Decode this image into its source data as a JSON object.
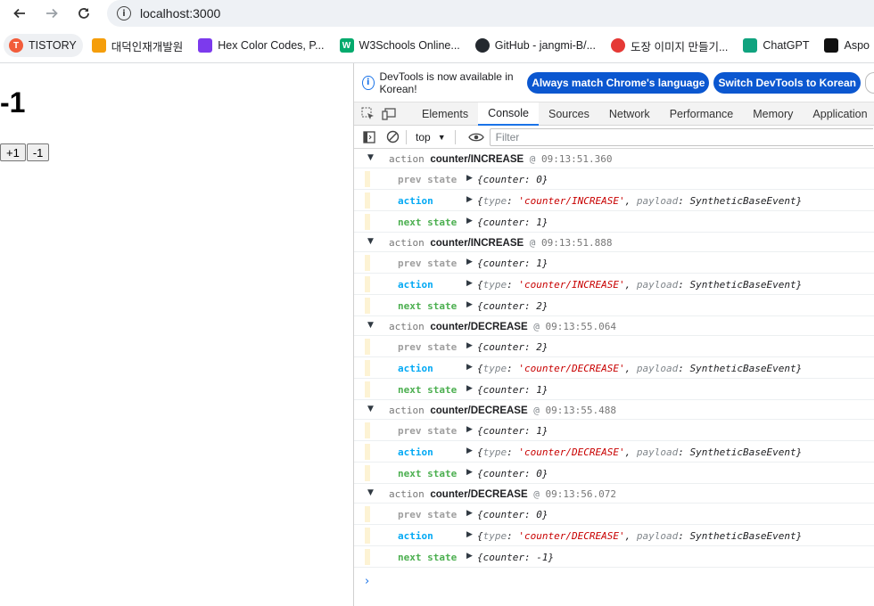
{
  "browser": {
    "url": "localhost:3000",
    "bookmarks": [
      {
        "label": "TISTORY",
        "icon": "tistory-icon",
        "color": "#f25c3a"
      },
      {
        "label": "대덕인재개발원",
        "icon": "orange-logo-icon",
        "color": "#f59e0b"
      },
      {
        "label": "Hex Color Codes, P...",
        "icon": "color-book-icon",
        "color": "#7c3aed"
      },
      {
        "label": "W3Schools Online...",
        "icon": "w3schools-icon",
        "color": "#04aa6d"
      },
      {
        "label": "GitHub - jangmi-B/...",
        "icon": "github-icon",
        "color": "#24292f"
      },
      {
        "label": "도장 이미지 만들기...",
        "icon": "stamp-icon",
        "color": "#e53935"
      },
      {
        "label": "ChatGPT",
        "icon": "chatgpt-icon",
        "color": "#10a37f"
      },
      {
        "label": "Aspo",
        "icon": "aspose-icon",
        "color": "#111111"
      }
    ]
  },
  "page": {
    "counter": "-1",
    "increment_label": "+1",
    "decrement_label": "-1"
  },
  "devtools": {
    "info_text": "DevTools is now available in Korean!",
    "match_language_label": "Always match Chrome's language",
    "switch_language_label": "Switch DevTools to Korean",
    "tabs": [
      "Elements",
      "Console",
      "Sources",
      "Network",
      "Performance",
      "Memory",
      "Application"
    ],
    "active_tab": "Console",
    "context": "top",
    "filter_placeholder": "Filter",
    "log_labels": {
      "prev": "prev state",
      "action": "action",
      "next": "next state"
    },
    "groups": [
      {
        "prefix": "action",
        "type": "counter/INCREASE",
        "at": "@",
        "time": "09:13:51.360",
        "prev": "{counter: 0}",
        "action_type": "'counter/INCREASE'",
        "payload": "SyntheticBaseEvent",
        "next": "{counter: 1}"
      },
      {
        "prefix": "action",
        "type": "counter/INCREASE",
        "at": "@",
        "time": "09:13:51.888",
        "prev": "{counter: 1}",
        "action_type": "'counter/INCREASE'",
        "payload": "SyntheticBaseEvent",
        "next": "{counter: 2}"
      },
      {
        "prefix": "action",
        "type": "counter/DECREASE",
        "at": "@",
        "time": "09:13:55.064",
        "prev": "{counter: 2}",
        "action_type": "'counter/DECREASE'",
        "payload": "SyntheticBaseEvent",
        "next": "{counter: 1}"
      },
      {
        "prefix": "action",
        "type": "counter/DECREASE",
        "at": "@",
        "time": "09:13:55.488",
        "prev": "{counter: 1}",
        "action_type": "'counter/DECREASE'",
        "payload": "SyntheticBaseEvent",
        "next": "{counter: 0}"
      },
      {
        "prefix": "action",
        "type": "counter/DECREASE",
        "at": "@",
        "time": "09:13:56.072",
        "prev": "{counter: 0}",
        "action_type": "'counter/DECREASE'",
        "payload": "SyntheticBaseEvent",
        "next": "{counter: -1}"
      }
    ]
  }
}
